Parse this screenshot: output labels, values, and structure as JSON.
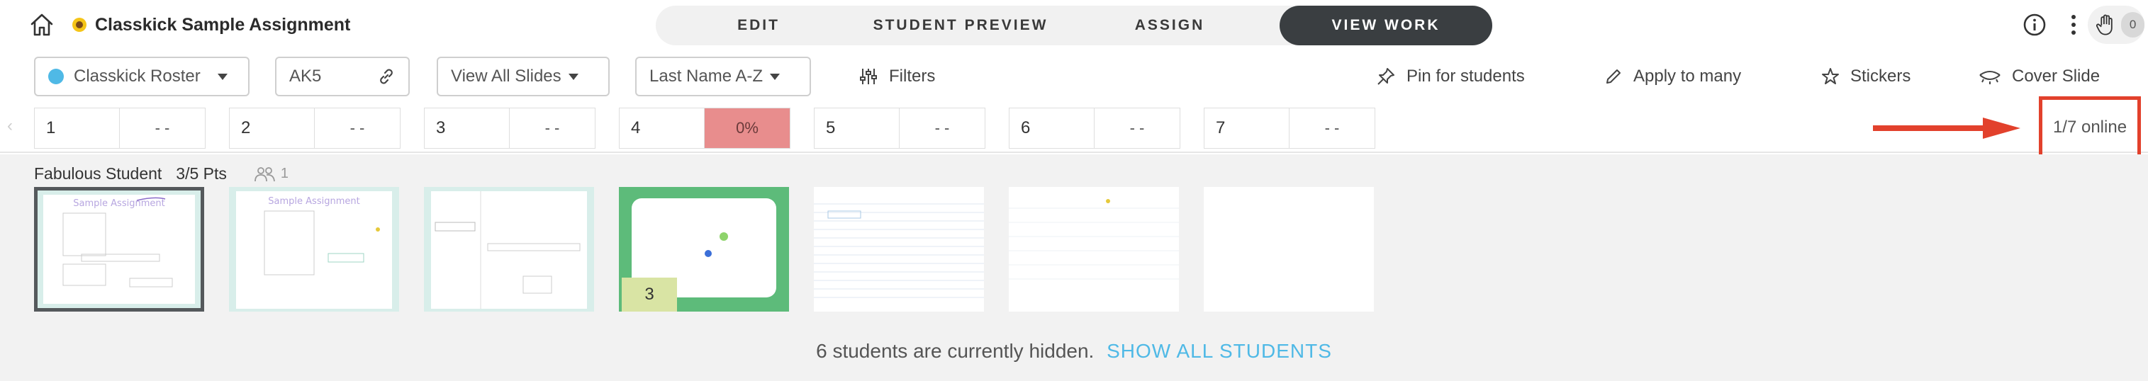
{
  "header": {
    "title": "Classkick Sample Assignment",
    "tabs": [
      {
        "label": "EDIT"
      },
      {
        "label": "STUDENT PREVIEW"
      },
      {
        "label": "ASSIGN"
      },
      {
        "label": "VIEW WORK",
        "active": true
      }
    ],
    "help_count": "0",
    "icons": [
      "home-icon",
      "sunflower-icon",
      "info-icon",
      "more-vertical-icon",
      "raised-hand-icon"
    ]
  },
  "toolbar": {
    "roster": "Classkick Roster",
    "code": "AK5",
    "view_filter": "View All Slides",
    "sort": "Last Name A-Z",
    "filters": "Filters",
    "pin": "Pin for students",
    "apply": "Apply to many",
    "stickers": "Stickers",
    "cover": "Cover Slide",
    "roster_color": "#4fb9e6"
  },
  "slides": [
    {
      "num": "1",
      "score": "- -"
    },
    {
      "num": "2",
      "score": "- -"
    },
    {
      "num": "3",
      "score": "- -"
    },
    {
      "num": "4",
      "score": "0%"
    },
    {
      "num": "5",
      "score": "- -"
    },
    {
      "num": "6",
      "score": "- -"
    },
    {
      "num": "7",
      "score": "- -"
    }
  ],
  "online_status": "1/7 online",
  "student": {
    "name": "Fabulous Student",
    "points": "3/5 Pts",
    "collaborators": "1",
    "slide4_badge": "3"
  },
  "hidden": {
    "message": "6 students are currently hidden.",
    "action": "SHOW ALL STUDENTS"
  },
  "colors": {
    "active_tab": "#3a3e41",
    "score_zero": "#e88d8d",
    "highlight_red": "#e2412c",
    "link_blue": "#4fb9e6",
    "slide4_green": "#5dbb7a"
  }
}
